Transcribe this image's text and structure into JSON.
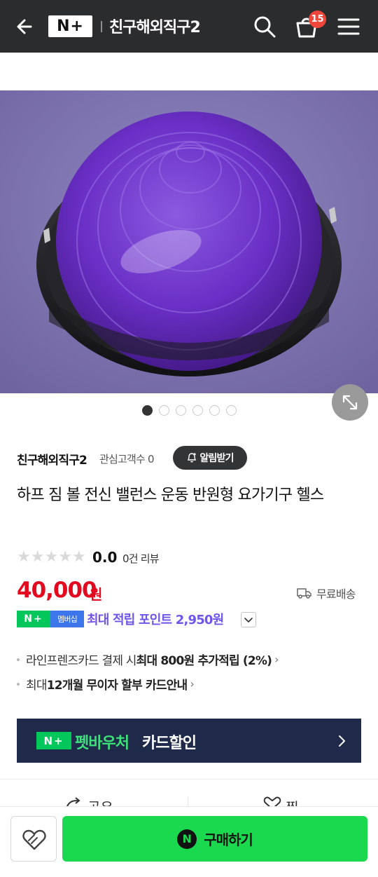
{
  "header": {
    "logo_text": "N+",
    "store_title": "친구해외직구2",
    "cart_count": "15"
  },
  "gallery": {
    "image_description": "Purple half balance ball with black base",
    "slide_count": 6,
    "active_slide": 1
  },
  "store": {
    "name": "친구해외직구2",
    "followers": "관심고객수 0",
    "alarm_label": "알림받기"
  },
  "product": {
    "title": "하프 짐 볼 전신 밸런스 운동 반원형 요가기구 헬스",
    "rating": "0.0",
    "review_count": "0건 리뷰",
    "price": "40,000",
    "price_unit": "원",
    "shipping": "무료배송"
  },
  "membership": {
    "logo_text": "N+",
    "label": "멤버십",
    "points_text": "최대 적립 포인트 2,950원"
  },
  "benefits": [
    {
      "prefix": "라인프렌즈카드 결제 시 ",
      "bold": "최대 800원 추가적립 (2%)"
    },
    {
      "prefix": "최대 ",
      "bold": "12개월 무이자 할부 카드안내"
    }
  ],
  "voucher": {
    "logo_text": "N+",
    "highlight": "펫바우처",
    "label": "카드할인"
  },
  "actions": {
    "share_label": "공유",
    "wish_label": "찜"
  },
  "bottom": {
    "npay_symbol": "N",
    "buy_label": "구매하기"
  },
  "colors": {
    "topbar": "#2b2c2e",
    "price": "#e10a1e",
    "points": "#7155e8",
    "naver_green": "#03c75a",
    "buy_button": "#1bd94f",
    "voucher_bg": "#1f2a4b"
  }
}
